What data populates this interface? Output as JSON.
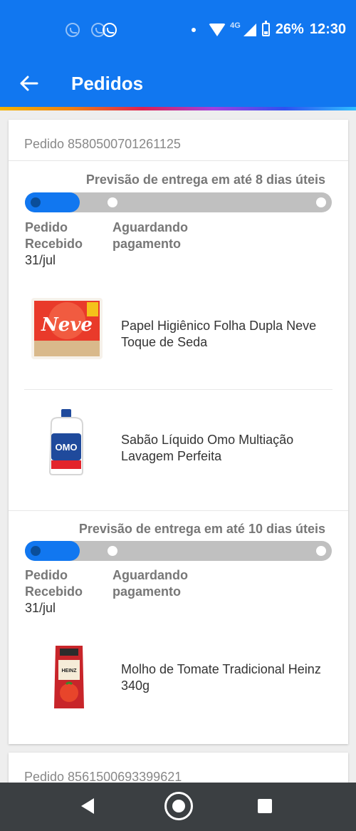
{
  "status_bar": {
    "notification_icons": [
      "whatsapp-icon",
      "whatsapp-icon",
      "whatsapp-icon"
    ],
    "network": "4G",
    "battery": "26%",
    "time": "12:30"
  },
  "app_bar": {
    "title": "Pedidos"
  },
  "orders": [
    {
      "label": "Pedido 8580500701261125",
      "shipments": [
        {
          "forecast": "Previsão de entrega em até 8 dias úteis",
          "progress": 0.18,
          "steps": [
            {
              "label_line1": "Pedido",
              "label_line2": "Recebido",
              "date": "31/jul"
            },
            {
              "label_line1": "Aguardando",
              "label_line2": "pagamento"
            }
          ],
          "products": [
            {
              "name": "Papel Higiênico Folha Dupla Neve Toque de Seda",
              "image_text": "Neve"
            },
            {
              "name": "Sabão Líquido Omo Multiação Lavagem Perfeita",
              "image_text": "OMO"
            }
          ]
        },
        {
          "forecast": "Previsão de entrega em até 10 dias úteis",
          "progress": 0.18,
          "steps": [
            {
              "label_line1": "Pedido",
              "label_line2": "Recebido",
              "date": "31/jul"
            },
            {
              "label_line1": "Aguardando",
              "label_line2": "pagamento"
            }
          ],
          "products": [
            {
              "name": "Molho de Tomate Tradicional Heinz 340g",
              "image_text": "HEINZ"
            }
          ]
        }
      ]
    },
    {
      "label": "Pedido 8561500693399621"
    }
  ],
  "nav_bar": {
    "icons": [
      "back-triangle-icon",
      "home-circle-icon",
      "recents-square-icon"
    ]
  },
  "colors": {
    "primary": "#1177f0",
    "track": "#c0c0c0"
  }
}
